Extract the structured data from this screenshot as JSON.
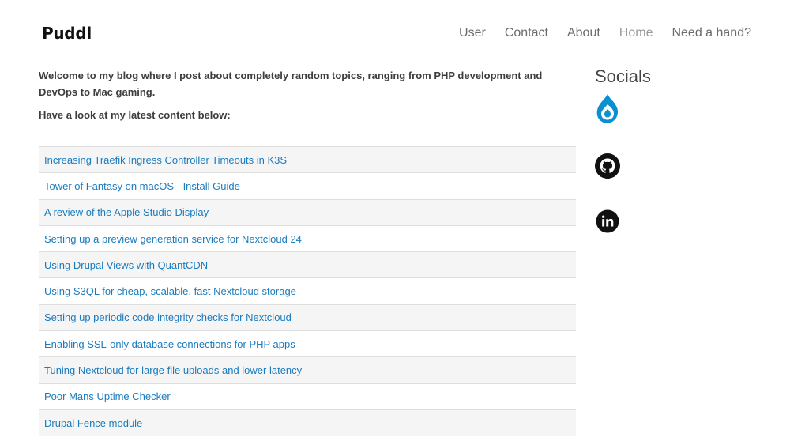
{
  "header": {
    "brand": "Puddl",
    "nav": [
      {
        "label": "User",
        "active": false
      },
      {
        "label": "Contact",
        "active": false
      },
      {
        "label": "About",
        "active": false
      },
      {
        "label": "Home",
        "active": true
      },
      {
        "label": "Need a hand?",
        "active": false
      }
    ]
  },
  "main": {
    "intro": "Welcome to my blog where I post about completely random topics, ranging from PHP development and DevOps to Mac gaming.",
    "intro2": "Have a look at my latest content below:",
    "posts": [
      "Increasing Traefik Ingress Controller Timeouts in K3S",
      "Tower of Fantasy on macOS - Install Guide",
      "A review of the Apple Studio Display",
      "Setting up a preview generation service for Nextcloud 24",
      "Using Drupal Views with QuantCDN",
      "Using S3QL for cheap, scalable, fast Nextcloud storage",
      "Setting up periodic code integrity checks for Nextcloud",
      "Enabling SSL-only database connections for PHP apps",
      "Tuning Nextcloud for large file uploads and lower latency",
      "Poor Mans Uptime Checker",
      "Drupal Fence module"
    ]
  },
  "sidebar": {
    "title": "Socials",
    "icons": [
      "drupal-icon",
      "github-icon",
      "linkedin-icon"
    ]
  },
  "colors": {
    "link": "#1a7bbf",
    "drupal": "#0a8fd1",
    "row_alt": "#f5f5f5"
  }
}
